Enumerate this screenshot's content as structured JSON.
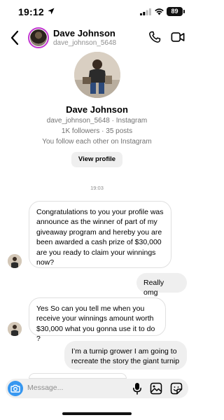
{
  "status_bar": {
    "time": "19:12",
    "battery": "89"
  },
  "header": {
    "name": "Dave Johnson",
    "handle": "dave_johnson_5648"
  },
  "profile": {
    "name": "Dave Johnson",
    "handle_line": "dave_johnson_5648 · Instagram",
    "stats_line": "1K followers · 35 posts",
    "follow_line": "You follow each other on Instagram",
    "view_profile_label": "View profile"
  },
  "timestamp": "19:03",
  "messages": [
    {
      "direction": "incoming",
      "text": "Congratulations to you your profile was announce as the winner of part of my giveaway program and hereby you are been awarded a cash prize of $30,000 are you ready to claim your winnings now?"
    },
    {
      "direction": "outgoing",
      "text": "Really omg"
    },
    {
      "direction": "incoming",
      "text": "Yes So can you tell me when you receive your winnings amount worth $30,000 what you gonna use it to do ?"
    },
    {
      "direction": "outgoing",
      "text": "I’m a turnip grower I am going to recreate the story the giant turnip"
    }
  ],
  "composer": {
    "placeholder": "Message..."
  },
  "icons": {
    "back": "chevron-left-icon",
    "call": "phone-icon",
    "video": "video-camera-icon",
    "camera": "camera-icon",
    "mic": "microphone-icon",
    "gallery": "image-icon",
    "sticker": "sticker-icon"
  },
  "colors": {
    "accent": "#3797f0",
    "story_ring": "#c237d1",
    "bubble_out": "#efefef"
  }
}
